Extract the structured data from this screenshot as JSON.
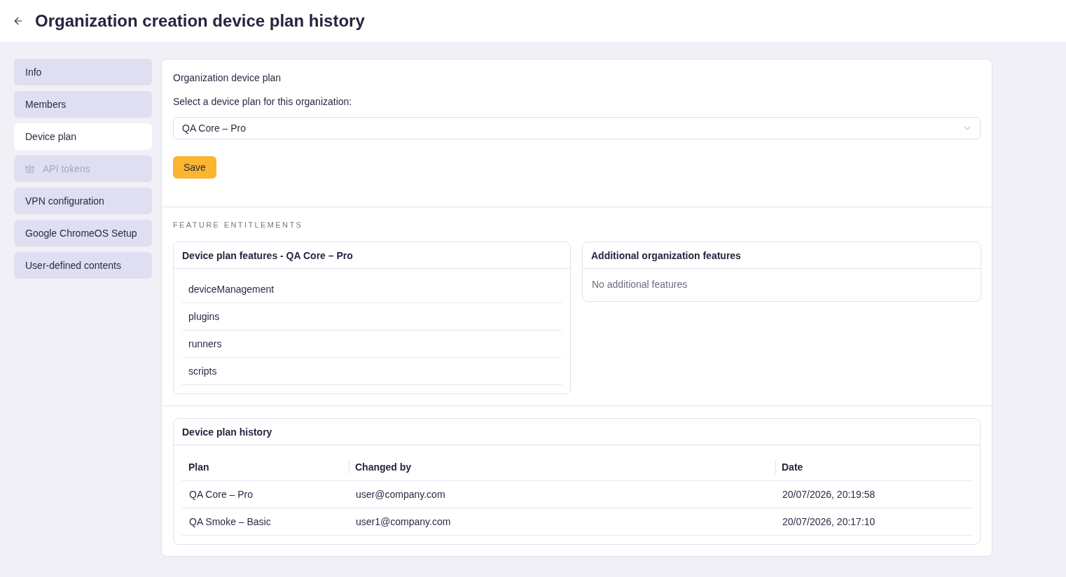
{
  "header": {
    "title": "Organization creation device plan history"
  },
  "sidebar": {
    "items": [
      {
        "label": "Info",
        "selected": false,
        "disabled": false
      },
      {
        "label": "Members",
        "selected": false,
        "disabled": false
      },
      {
        "label": "Device plan",
        "selected": true,
        "disabled": false
      },
      {
        "label": "API tokens",
        "selected": false,
        "disabled": true
      },
      {
        "label": "VPN configuration",
        "selected": false,
        "disabled": false
      },
      {
        "label": "Google ChromeOS Setup",
        "selected": false,
        "disabled": false
      },
      {
        "label": "User-defined contents",
        "selected": false,
        "disabled": false
      }
    ]
  },
  "device_plan": {
    "heading": "Organization device plan",
    "label": "Select a device plan for this organization:",
    "select": {
      "value": "QA Core – Pro"
    },
    "save_button": "Save"
  },
  "feature_entitlements": {
    "heading": "FEATURE ENTITLEMENTS",
    "plan_features": {
      "title": "Device plan features - QA Core – Pro",
      "items": [
        "deviceManagement",
        "plugins",
        "runners",
        "scripts"
      ]
    },
    "additional_features": {
      "title": "Additional organization features",
      "empty_text": "No additional features"
    }
  },
  "history": {
    "title": "Device plan history",
    "columns": [
      "Plan",
      "Changed by",
      "Date"
    ],
    "rows": [
      [
        "QA Core – Pro",
        "user@company.com",
        "20/07/2026, 20:19:58"
      ],
      [
        "QA Smoke – Basic",
        "user1@company.com",
        "20/07/2026, 20:17:10"
      ]
    ]
  }
}
